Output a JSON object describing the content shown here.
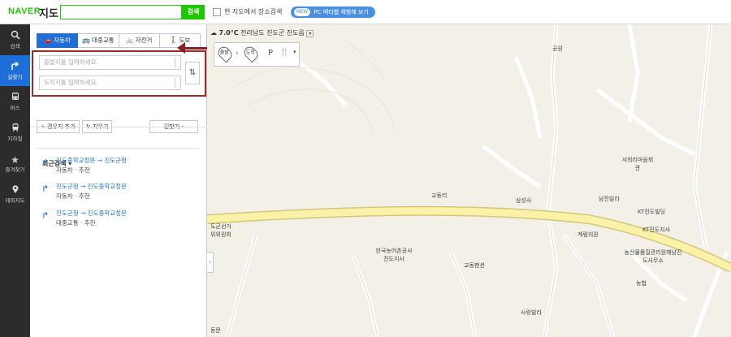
{
  "header": {
    "logo": "NAVER",
    "title": "지도",
    "search_button": "검색",
    "search_placeholder": "",
    "checkbox_label": "현 지도에서 장소검색",
    "beta_badge": "NEW",
    "beta_label": "PC 베타웹 체험해 보기"
  },
  "leftnav": [
    {
      "label": "검색",
      "icon": "search-icon"
    },
    {
      "label": "길찾기",
      "icon": "directions-icon"
    },
    {
      "label": "버스",
      "icon": "bus-icon"
    },
    {
      "label": "지하철",
      "icon": "subway-icon"
    },
    {
      "label": "즐겨찾기",
      "icon": "star-icon"
    },
    {
      "label": "테마지도",
      "icon": "map-pin-icon"
    }
  ],
  "tabs": [
    {
      "label": "자동차",
      "icon": "car-icon"
    },
    {
      "label": "대중교통",
      "icon": "bus-icon"
    },
    {
      "label": "자전거",
      "icon": "bicycle-icon"
    },
    {
      "label": "도보",
      "icon": "walk-icon"
    }
  ],
  "route": {
    "origin_placeholder": "출발지를 입력하세요.",
    "destination_placeholder": "도착지를 입력하세요."
  },
  "actions": {
    "add_waypoint": "경유지 추가",
    "clear": "지우기",
    "find_route": "길찾기 ›"
  },
  "recent": {
    "title": "최근검색",
    "items": [
      {
        "route": "진도중학교정문 → 진도군청",
        "meta": "자동차 · 추천"
      },
      {
        "route": "진도군청 → 진도중학교정문",
        "meta": "자동차 · 추천"
      },
      {
        "route": "진도군청 → 진도중학교정문",
        "meta": "대중교통 · 추천"
      }
    ]
  },
  "map": {
    "temperature": "7.0°C",
    "location": "전라남도 진도군 진도읍",
    "start_pin": "출발",
    "end_pin": "도착",
    "labels": [
      "공원",
      "교동리",
      "삼성사",
      "서외리마을회관",
      "남진빌라",
      "KT진도빌딩",
      "KT진도지사",
      "계림의원",
      "농산물품질관리원해남진도사무소",
      "농협",
      "한국농어촌공사진도지사",
      "교동팬션",
      "사랑빌라",
      "도군선거위위원회",
      "동문"
    ]
  },
  "colors": {
    "brand_green": "#1ec800",
    "accent_blue": "#1e6fd9",
    "highlight_red": "#9b2a2a",
    "map_bg": "#f3f0e8",
    "main_road": "#fbf1a8"
  }
}
